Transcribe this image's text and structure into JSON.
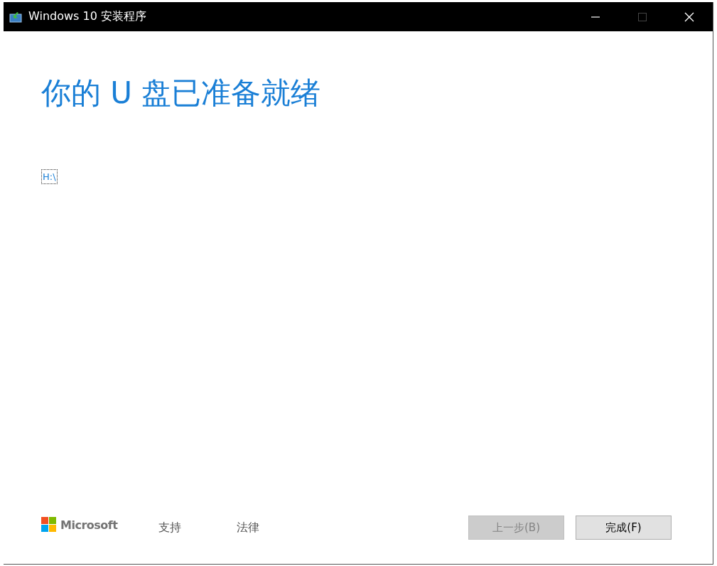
{
  "window": {
    "title": "Windows 10 安装程序",
    "controls": [
      {
        "kind": "minimize",
        "disabled": false
      },
      {
        "kind": "maximize",
        "disabled": true
      },
      {
        "kind": "close",
        "disabled": false
      }
    ]
  },
  "heading": "你的 U 盘已准备就绪",
  "drives": [
    {
      "label": "H:\\",
      "focused": true
    }
  ],
  "footer": {
    "brand": "Microsoft",
    "links": [
      "支持",
      "法律"
    ]
  },
  "buttons": [
    {
      "label": "上一步(B)",
      "disabled": true
    },
    {
      "label": "完成(F)",
      "disabled": false
    }
  ]
}
